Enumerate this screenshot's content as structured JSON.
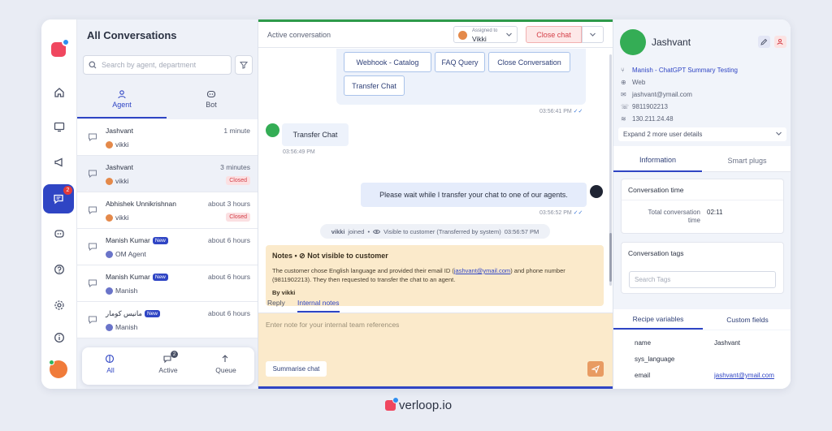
{
  "rail": {
    "chat_badge_count": "2",
    "icons": [
      "home-icon",
      "monitor-chat-icon",
      "megaphone-icon",
      "conversations-icon",
      "bot-icon",
      "help-icon",
      "settings-icon",
      "info-icon"
    ]
  },
  "list": {
    "title": "All Conversations",
    "search_placeholder": "Search by agent, department",
    "segments": [
      {
        "label": "Agent"
      },
      {
        "label": "Bot"
      }
    ],
    "rows": [
      {
        "name": "Jashvant",
        "time": "1 minute",
        "agent": "vikki",
        "status": ""
      },
      {
        "name": "Jashvant",
        "time": "3 minutes",
        "agent": "vikki",
        "status": "Closed"
      },
      {
        "name": "Abhishek Unnikrishnan",
        "time": "about 3 hours",
        "agent": "vikki",
        "status": "Closed"
      },
      {
        "name": "Manish Kumar",
        "badge": "New",
        "time": "about 6 hours",
        "agent": "OM Agent",
        "status": ""
      },
      {
        "name": "Manish Kumar",
        "badge": "New",
        "time": "about 6 hours",
        "agent": "Manish",
        "status": ""
      },
      {
        "name": "مانيس كومار",
        "badge": "New",
        "time": "about 6 hours",
        "agent": "Manish",
        "status": ""
      }
    ],
    "bottom_tabs": [
      {
        "label": "All"
      },
      {
        "label": "Active",
        "count": "2"
      },
      {
        "label": "Queue"
      }
    ]
  },
  "chat": {
    "header_label": "Active conversation",
    "assigned_to_label": "Assigned to",
    "assigned_to_value": "Vikki",
    "close_button": "Close chat",
    "quick_replies": [
      "Webhook - Catalog",
      "FAQ Query",
      "Close Conversation",
      "Transfer Chat"
    ],
    "quick_replies_time": "03:56:41 PM",
    "user_message": "Transfer Chat",
    "user_message_time": "03:56:49 PM",
    "bot_message": "Please wait while I transfer your chat to one of our agents.",
    "bot_message_time": "03:56:52 PM",
    "system_event": {
      "actor": "vikki",
      "action": "joined",
      "visibility": "Visible to customer (Transferred by system)",
      "time": "03:56:57 PM"
    },
    "note": {
      "title": "Notes •",
      "title_suffix": "Not visible to customer",
      "text_before": "The customer chose English language and provided their email ID (",
      "email": "jashvant@ymail.com",
      "text_after": ") and phone number (9811902213). They then requested to transfer the chat to an agent.",
      "by": "By vikki"
    },
    "reply_tabs": [
      {
        "label": "Reply"
      },
      {
        "label": "Internal notes"
      }
    ],
    "editor_placeholder": "Enter note for your internal team references",
    "summarise_button": "Summarise chat"
  },
  "profile": {
    "name": "Jashvant",
    "project": "Manish - ChatGPT Summary Testing",
    "channel": "Web",
    "email": "jashvant@ymail.com",
    "phone": "9811902213",
    "ip": "130.211.24.48",
    "expand_label": "Expand 2 more user details",
    "tabs": [
      {
        "label": "Information"
      },
      {
        "label": "Smart plugs"
      }
    ],
    "conversation_time": {
      "title": "Conversation time",
      "key": "Total conversation time",
      "value": "02:11"
    },
    "tags": {
      "title": "Conversation tags",
      "placeholder": "Search Tags"
    },
    "var_tabs": [
      {
        "label": "Recipe variables"
      },
      {
        "label": "Custom fields"
      }
    ],
    "variables": [
      {
        "key": "name",
        "value": "Jashvant"
      },
      {
        "key": "sys_language",
        "value": ""
      },
      {
        "key": "email",
        "value": "jashvant@ymail.com"
      }
    ]
  },
  "brand": {
    "name": "verloop.io"
  },
  "colors": {
    "primary": "#2f45c4",
    "danger": "#d43d46",
    "note_bg": "#fbeacb",
    "online": "#34ad55"
  }
}
